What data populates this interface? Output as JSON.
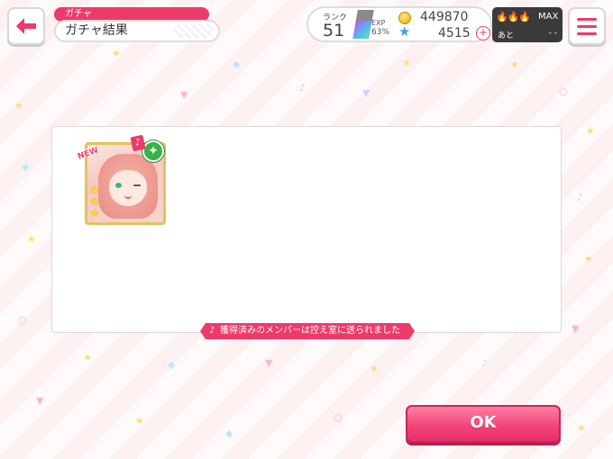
{
  "header": {
    "back_icon": "back-arrow-icon",
    "section_tag": "ガチャ",
    "page_title": "ガチャ結果",
    "menu_icon": "hamburger-menu-icon"
  },
  "status": {
    "rank_label": "ランク",
    "rank_value": "51",
    "exp_label": "EXP",
    "exp_percent": "63%",
    "exp_fraction": 0.63,
    "coin_icon": "coin-icon",
    "coins": "449870",
    "star_icon": "star-gem-icon",
    "stars": "4515",
    "plus_icon": "plus-icon"
  },
  "boost": {
    "flame_icons": "flame-icon",
    "max_label": "MAX",
    "remaining_label": "あと",
    "remaining_value": "- -"
  },
  "results": {
    "cards": [
      {
        "badge": "NEW",
        "band_icon": "band-logo-icon",
        "attribute_icon": "happy-attribute-icon",
        "rarity": 3
      }
    ],
    "notice": "獲得済みのメンバーは控え室に送られました"
  },
  "ok_button": "OK",
  "colors": {
    "accent": "#ee3a6a",
    "attribute_green": "#36b24a",
    "card_frame_gold": "#e6c25c",
    "gem_blue": "#3aa6e8"
  }
}
